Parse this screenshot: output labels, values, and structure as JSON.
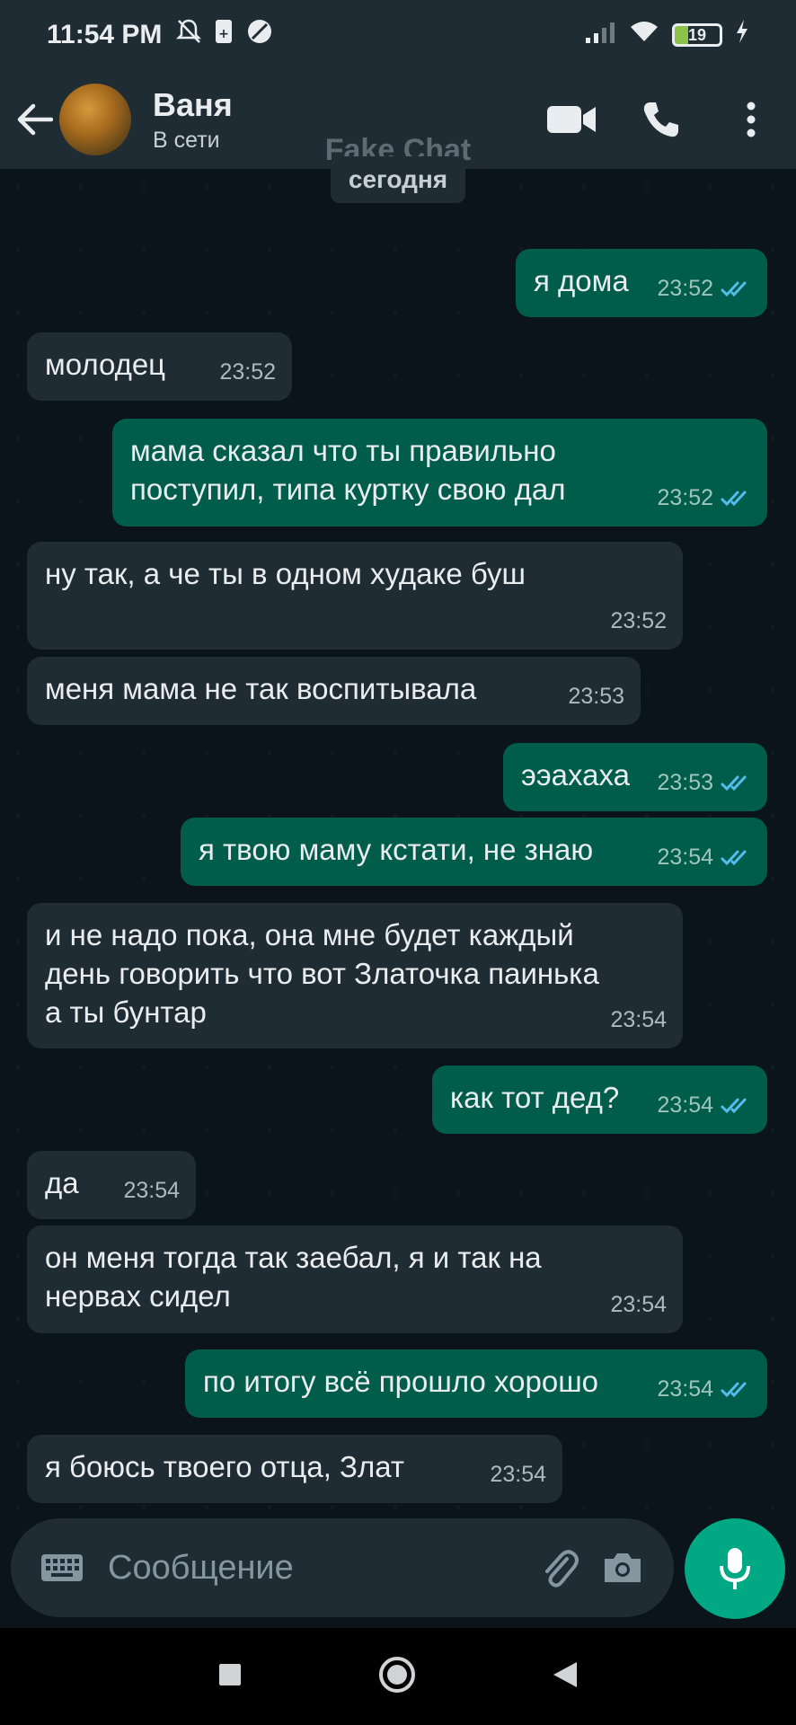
{
  "status_bar": {
    "time": "11:54 PM",
    "icons": [
      "muted-bell-icon",
      "sim-icon",
      "no-disturb-icon"
    ],
    "right_icons": [
      "signal-icon",
      "wifi-icon",
      "battery-icon",
      "charging-icon"
    ],
    "battery": "19"
  },
  "header": {
    "back_icon": "arrow-left-icon",
    "contact_name": "Ваня",
    "contact_status": "В сети",
    "actions": [
      "video-call-icon",
      "phone-icon",
      "more-vert-icon"
    ]
  },
  "chat": {
    "watermark": "Fake Chat",
    "date_label": "сегодня",
    "messages": [
      {
        "dir": "out",
        "text": "я дома",
        "time": "23:52",
        "read": true
      },
      {
        "dir": "in",
        "text": "молодец",
        "time": "23:52"
      },
      {
        "dir": "out",
        "text": "мама сказал что ты правильно\nпоступил, типа куртку свою дал",
        "time": "23:52",
        "read": true
      },
      {
        "dir": "in",
        "text": "ну так, а че ты в одном худаке буш",
        "time": "23:52"
      },
      {
        "dir": "in",
        "text": "меня мама не так воспитывала",
        "time": "23:53"
      },
      {
        "dir": "out",
        "text": "ээахаха",
        "time": "23:53",
        "read": true
      },
      {
        "dir": "out",
        "text": "я твою маму кстати, не знаю",
        "time": "23:54",
        "read": true
      },
      {
        "dir": "in",
        "text": "и не надо пока, она мне будет каждый\nдень говорить что вот Златочка паинька\nа ты бунтар",
        "time": "23:54"
      },
      {
        "dir": "out",
        "text": "как тот дед?",
        "time": "23:54",
        "read": true
      },
      {
        "dir": "in",
        "text": "да",
        "time": "23:54"
      },
      {
        "dir": "in",
        "text": "он меня тогда так заебал, я и так на\nнервах сидел",
        "time": "23:54"
      },
      {
        "dir": "out",
        "text": "по итогу всё прошло хорошо",
        "time": "23:54",
        "read": true
      },
      {
        "dir": "in",
        "text": "я боюсь твоего отца, Злат",
        "time": "23:54"
      }
    ]
  },
  "input": {
    "placeholder": "Сообщение",
    "icons": [
      "keyboard-icon",
      "attach-icon",
      "camera-icon"
    ],
    "send_icon": "mic-icon"
  },
  "nav": {
    "buttons": [
      "recents-square-icon",
      "home-circle-icon",
      "back-triangle-icon"
    ]
  },
  "colors": {
    "background": "#0b141a",
    "header": "#1f2c34",
    "incoming": "#202c33",
    "outgoing": "#005c4b",
    "read_tick": "#53bdeb",
    "accent": "#00a884"
  }
}
